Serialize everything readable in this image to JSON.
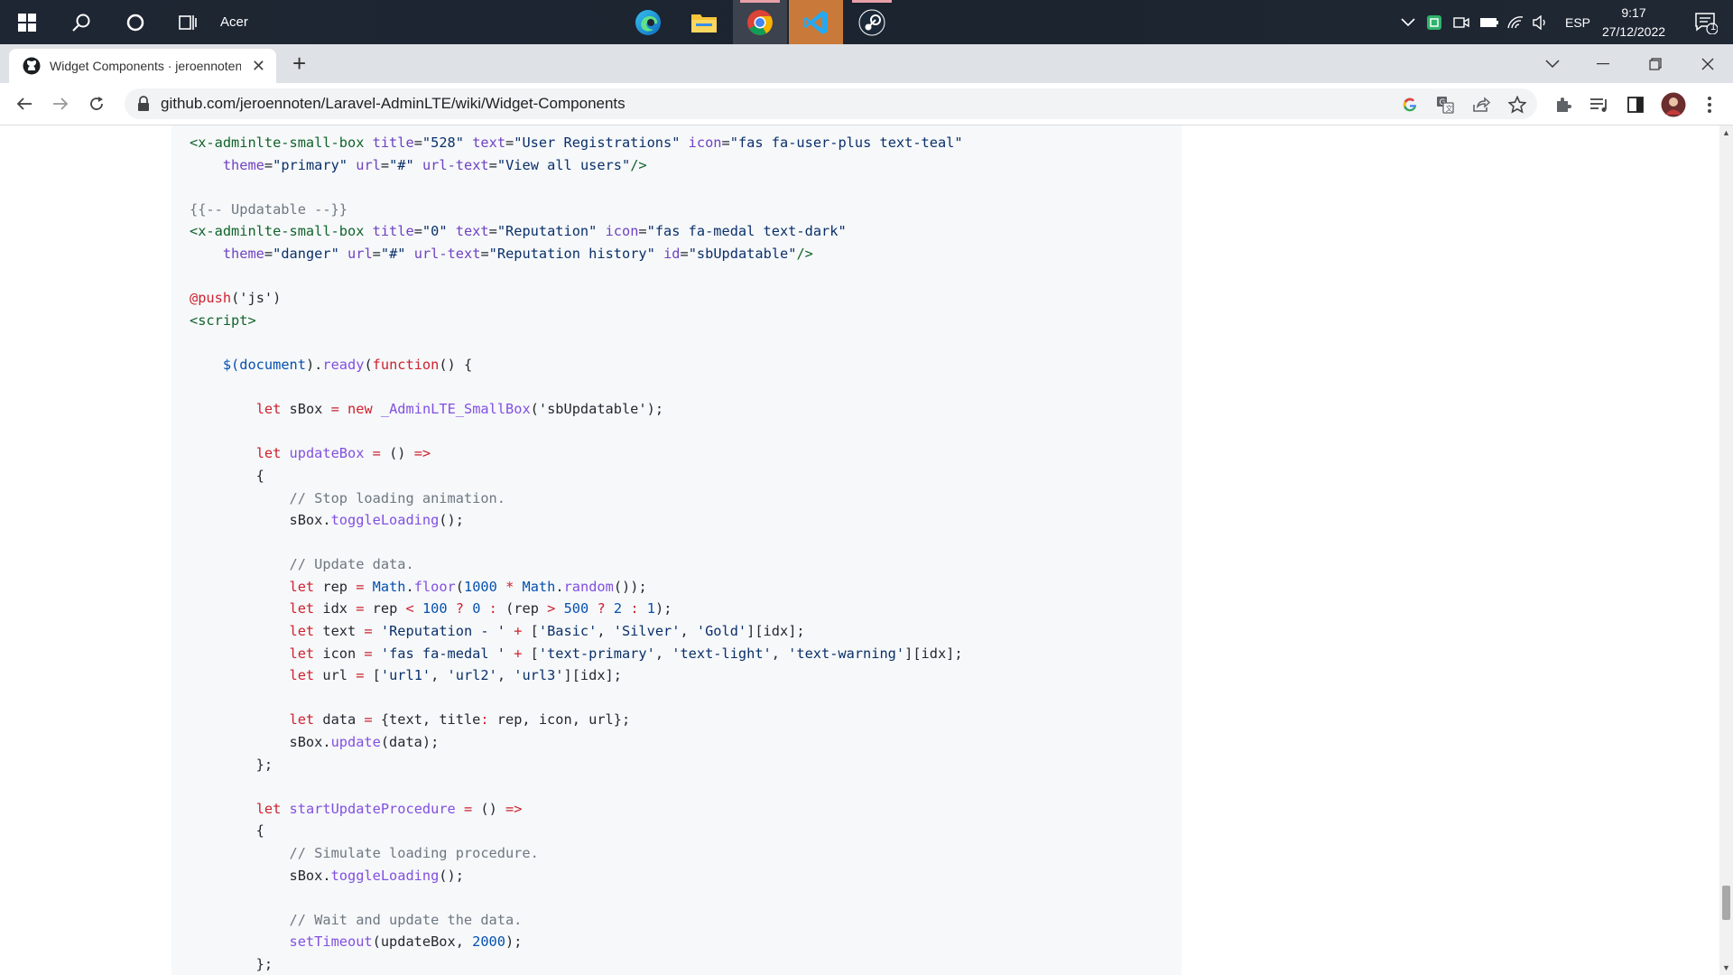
{
  "taskbar": {
    "user_label": "Acer",
    "apps": [
      {
        "name": "edge-app",
        "active": false
      },
      {
        "name": "file-explorer-app",
        "active": false
      },
      {
        "name": "chrome-app",
        "active": true
      },
      {
        "name": "vscode-app",
        "active": true
      },
      {
        "name": "steam-app",
        "active": false
      }
    ],
    "tray": {
      "language": "ESP",
      "time": "9:17",
      "date": "27/12/2022",
      "notification_count": "1"
    }
  },
  "browser": {
    "tab": {
      "title": "Widget Components · jeroennoten/Laravel-AdminLTE Wiki"
    },
    "url": "github.com/jeroennoten/Laravel-AdminLTE/wiki/Widget-Components"
  },
  "code": [
    [
      {
        "t": "tag",
        "v": "<x-adminlte-small-box"
      },
      {
        "t": "pl",
        "v": " "
      },
      {
        "t": "attr",
        "v": "title"
      },
      {
        "t": "pl",
        "v": "="
      },
      {
        "t": "str",
        "v": "\"528\""
      },
      {
        "t": "pl",
        "v": " "
      },
      {
        "t": "attr",
        "v": "text"
      },
      {
        "t": "pl",
        "v": "="
      },
      {
        "t": "str",
        "v": "\"User Registrations\""
      },
      {
        "t": "pl",
        "v": " "
      },
      {
        "t": "attr",
        "v": "icon"
      },
      {
        "t": "pl",
        "v": "="
      },
      {
        "t": "str",
        "v": "\"fas fa-user-plus text-teal\""
      }
    ],
    [
      {
        "t": "pl",
        "v": "    "
      },
      {
        "t": "attr",
        "v": "theme"
      },
      {
        "t": "pl",
        "v": "="
      },
      {
        "t": "str",
        "v": "\"primary\""
      },
      {
        "t": "pl",
        "v": " "
      },
      {
        "t": "attr",
        "v": "url"
      },
      {
        "t": "pl",
        "v": "="
      },
      {
        "t": "str",
        "v": "\"#\""
      },
      {
        "t": "pl",
        "v": " "
      },
      {
        "t": "attr",
        "v": "url-text"
      },
      {
        "t": "pl",
        "v": "="
      },
      {
        "t": "str",
        "v": "\"View all users\""
      },
      {
        "t": "tag",
        "v": "/>"
      }
    ],
    [],
    [
      {
        "t": "cm",
        "v": "{{-- Updatable --}}"
      }
    ],
    [
      {
        "t": "tag",
        "v": "<x-adminlte-small-box"
      },
      {
        "t": "pl",
        "v": " "
      },
      {
        "t": "attr",
        "v": "title"
      },
      {
        "t": "pl",
        "v": "="
      },
      {
        "t": "str",
        "v": "\"0\""
      },
      {
        "t": "pl",
        "v": " "
      },
      {
        "t": "attr",
        "v": "text"
      },
      {
        "t": "pl",
        "v": "="
      },
      {
        "t": "str",
        "v": "\"Reputation\""
      },
      {
        "t": "pl",
        "v": " "
      },
      {
        "t": "attr",
        "v": "icon"
      },
      {
        "t": "pl",
        "v": "="
      },
      {
        "t": "str",
        "v": "\"fas fa-medal text-dark\""
      }
    ],
    [
      {
        "t": "pl",
        "v": "    "
      },
      {
        "t": "attr",
        "v": "theme"
      },
      {
        "t": "pl",
        "v": "="
      },
      {
        "t": "str",
        "v": "\"danger\""
      },
      {
        "t": "pl",
        "v": " "
      },
      {
        "t": "attr",
        "v": "url"
      },
      {
        "t": "pl",
        "v": "="
      },
      {
        "t": "str",
        "v": "\"#\""
      },
      {
        "t": "pl",
        "v": " "
      },
      {
        "t": "attr",
        "v": "url-text"
      },
      {
        "t": "pl",
        "v": "="
      },
      {
        "t": "str",
        "v": "\"Reputation history\""
      },
      {
        "t": "pl",
        "v": " "
      },
      {
        "t": "attr",
        "v": "id"
      },
      {
        "t": "pl",
        "v": "="
      },
      {
        "t": "str",
        "v": "\"sbUpdatable\""
      },
      {
        "t": "tag",
        "v": "/>"
      }
    ],
    [],
    [
      {
        "t": "kw",
        "v": "@push"
      },
      {
        "t": "pl",
        "v": "('js')"
      }
    ],
    [
      {
        "t": "tag",
        "v": "<script>"
      }
    ],
    [],
    [
      {
        "t": "pl",
        "v": "    "
      },
      {
        "t": "num",
        "v": "$("
      },
      {
        "t": "num",
        "v": "document"
      },
      {
        "t": "pl",
        "v": ")."
      },
      {
        "t": "fn",
        "v": "ready"
      },
      {
        "t": "pl",
        "v": "("
      },
      {
        "t": "kw",
        "v": "function"
      },
      {
        "t": "pl",
        "v": "() {"
      }
    ],
    [],
    [
      {
        "t": "pl",
        "v": "        "
      },
      {
        "t": "kw",
        "v": "let"
      },
      {
        "t": "pl",
        "v": " sBox "
      },
      {
        "t": "kw",
        "v": "="
      },
      {
        "t": "pl",
        "v": " "
      },
      {
        "t": "kw",
        "v": "new"
      },
      {
        "t": "pl",
        "v": " "
      },
      {
        "t": "fn",
        "v": "_AdminLTE_SmallBox"
      },
      {
        "t": "pl",
        "v": "('sbUpdatable');"
      }
    ],
    [],
    [
      {
        "t": "pl",
        "v": "        "
      },
      {
        "t": "kw",
        "v": "let"
      },
      {
        "t": "pl",
        "v": " "
      },
      {
        "t": "fn",
        "v": "updateBox"
      },
      {
        "t": "pl",
        "v": " "
      },
      {
        "t": "kw",
        "v": "="
      },
      {
        "t": "pl",
        "v": " () "
      },
      {
        "t": "kw",
        "v": "=>"
      }
    ],
    [
      {
        "t": "pl",
        "v": "        {"
      }
    ],
    [
      {
        "t": "pl",
        "v": "            "
      },
      {
        "t": "cm",
        "v": "// Stop loading animation."
      }
    ],
    [
      {
        "t": "pl",
        "v": "            sBox."
      },
      {
        "t": "fn",
        "v": "toggleLoading"
      },
      {
        "t": "pl",
        "v": "();"
      }
    ],
    [],
    [
      {
        "t": "pl",
        "v": "            "
      },
      {
        "t": "cm",
        "v": "// Update data."
      }
    ],
    [
      {
        "t": "pl",
        "v": "            "
      },
      {
        "t": "kw",
        "v": "let"
      },
      {
        "t": "pl",
        "v": " rep "
      },
      {
        "t": "kw",
        "v": "="
      },
      {
        "t": "pl",
        "v": " "
      },
      {
        "t": "num",
        "v": "Math"
      },
      {
        "t": "pl",
        "v": "."
      },
      {
        "t": "fn",
        "v": "floor"
      },
      {
        "t": "pl",
        "v": "("
      },
      {
        "t": "num",
        "v": "1000"
      },
      {
        "t": "pl",
        "v": " "
      },
      {
        "t": "kw",
        "v": "*"
      },
      {
        "t": "pl",
        "v": " "
      },
      {
        "t": "num",
        "v": "Math"
      },
      {
        "t": "pl",
        "v": "."
      },
      {
        "t": "fn",
        "v": "random"
      },
      {
        "t": "pl",
        "v": "());"
      }
    ],
    [
      {
        "t": "pl",
        "v": "            "
      },
      {
        "t": "kw",
        "v": "let"
      },
      {
        "t": "pl",
        "v": " idx "
      },
      {
        "t": "kw",
        "v": "="
      },
      {
        "t": "pl",
        "v": " rep "
      },
      {
        "t": "kw",
        "v": "<"
      },
      {
        "t": "pl",
        "v": " "
      },
      {
        "t": "num",
        "v": "100"
      },
      {
        "t": "pl",
        "v": " "
      },
      {
        "t": "kw",
        "v": "?"
      },
      {
        "t": "pl",
        "v": " "
      },
      {
        "t": "num",
        "v": "0"
      },
      {
        "t": "pl",
        "v": " "
      },
      {
        "t": "kw",
        "v": ":"
      },
      {
        "t": "pl",
        "v": " (rep "
      },
      {
        "t": "kw",
        "v": ">"
      },
      {
        "t": "pl",
        "v": " "
      },
      {
        "t": "num",
        "v": "500"
      },
      {
        "t": "pl",
        "v": " "
      },
      {
        "t": "kw",
        "v": "?"
      },
      {
        "t": "pl",
        "v": " "
      },
      {
        "t": "num",
        "v": "2"
      },
      {
        "t": "pl",
        "v": " "
      },
      {
        "t": "kw",
        "v": ":"
      },
      {
        "t": "pl",
        "v": " "
      },
      {
        "t": "num",
        "v": "1"
      },
      {
        "t": "pl",
        "v": ");"
      }
    ],
    [
      {
        "t": "pl",
        "v": "            "
      },
      {
        "t": "kw",
        "v": "let"
      },
      {
        "t": "pl",
        "v": " text "
      },
      {
        "t": "kw",
        "v": "="
      },
      {
        "t": "pl",
        "v": " "
      },
      {
        "t": "str",
        "v": "'Reputation - '"
      },
      {
        "t": "pl",
        "v": " "
      },
      {
        "t": "kw",
        "v": "+"
      },
      {
        "t": "pl",
        "v": " ["
      },
      {
        "t": "str",
        "v": "'Basic'"
      },
      {
        "t": "pl",
        "v": ", "
      },
      {
        "t": "str",
        "v": "'Silver'"
      },
      {
        "t": "pl",
        "v": ", "
      },
      {
        "t": "str",
        "v": "'Gold'"
      },
      {
        "t": "pl",
        "v": "][idx];"
      }
    ],
    [
      {
        "t": "pl",
        "v": "            "
      },
      {
        "t": "kw",
        "v": "let"
      },
      {
        "t": "pl",
        "v": " icon "
      },
      {
        "t": "kw",
        "v": "="
      },
      {
        "t": "pl",
        "v": " "
      },
      {
        "t": "str",
        "v": "'fas fa-medal '"
      },
      {
        "t": "pl",
        "v": " "
      },
      {
        "t": "kw",
        "v": "+"
      },
      {
        "t": "pl",
        "v": " ["
      },
      {
        "t": "str",
        "v": "'text-primary'"
      },
      {
        "t": "pl",
        "v": ", "
      },
      {
        "t": "str",
        "v": "'text-light'"
      },
      {
        "t": "pl",
        "v": ", "
      },
      {
        "t": "str",
        "v": "'text-warning'"
      },
      {
        "t": "pl",
        "v": "][idx];"
      }
    ],
    [
      {
        "t": "pl",
        "v": "            "
      },
      {
        "t": "kw",
        "v": "let"
      },
      {
        "t": "pl",
        "v": " url "
      },
      {
        "t": "kw",
        "v": "="
      },
      {
        "t": "pl",
        "v": " ["
      },
      {
        "t": "str",
        "v": "'url1'"
      },
      {
        "t": "pl",
        "v": ", "
      },
      {
        "t": "str",
        "v": "'url2'"
      },
      {
        "t": "pl",
        "v": ", "
      },
      {
        "t": "str",
        "v": "'url3'"
      },
      {
        "t": "pl",
        "v": "][idx];"
      }
    ],
    [],
    [
      {
        "t": "pl",
        "v": "            "
      },
      {
        "t": "kw",
        "v": "let"
      },
      {
        "t": "pl",
        "v": " data "
      },
      {
        "t": "kw",
        "v": "="
      },
      {
        "t": "pl",
        "v": " {text, title"
      },
      {
        "t": "kw",
        "v": ":"
      },
      {
        "t": "pl",
        "v": " rep, icon, url};"
      }
    ],
    [
      {
        "t": "pl",
        "v": "            sBox."
      },
      {
        "t": "fn",
        "v": "update"
      },
      {
        "t": "pl",
        "v": "(data);"
      }
    ],
    [
      {
        "t": "pl",
        "v": "        };"
      }
    ],
    [],
    [
      {
        "t": "pl",
        "v": "        "
      },
      {
        "t": "kw",
        "v": "let"
      },
      {
        "t": "pl",
        "v": " "
      },
      {
        "t": "fn",
        "v": "startUpdateProcedure"
      },
      {
        "t": "pl",
        "v": " "
      },
      {
        "t": "kw",
        "v": "="
      },
      {
        "t": "pl",
        "v": " () "
      },
      {
        "t": "kw",
        "v": "=>"
      }
    ],
    [
      {
        "t": "pl",
        "v": "        {"
      }
    ],
    [
      {
        "t": "pl",
        "v": "            "
      },
      {
        "t": "cm",
        "v": "// Simulate loading procedure."
      }
    ],
    [
      {
        "t": "pl",
        "v": "            sBox."
      },
      {
        "t": "fn",
        "v": "toggleLoading"
      },
      {
        "t": "pl",
        "v": "();"
      }
    ],
    [],
    [
      {
        "t": "pl",
        "v": "            "
      },
      {
        "t": "cm",
        "v": "// Wait and update the data."
      }
    ],
    [
      {
        "t": "pl",
        "v": "            "
      },
      {
        "t": "fn",
        "v": "setTimeout"
      },
      {
        "t": "pl",
        "v": "(updateBox, "
      },
      {
        "t": "num",
        "v": "2000"
      },
      {
        "t": "pl",
        "v": ");"
      }
    ],
    [
      {
        "t": "pl",
        "v": "        };"
      }
    ]
  ],
  "colors": {
    "taskbar_bg": "#1f2633",
    "tab_strip_bg": "#dee1e6",
    "code_bg": "#f6f8fa"
  }
}
